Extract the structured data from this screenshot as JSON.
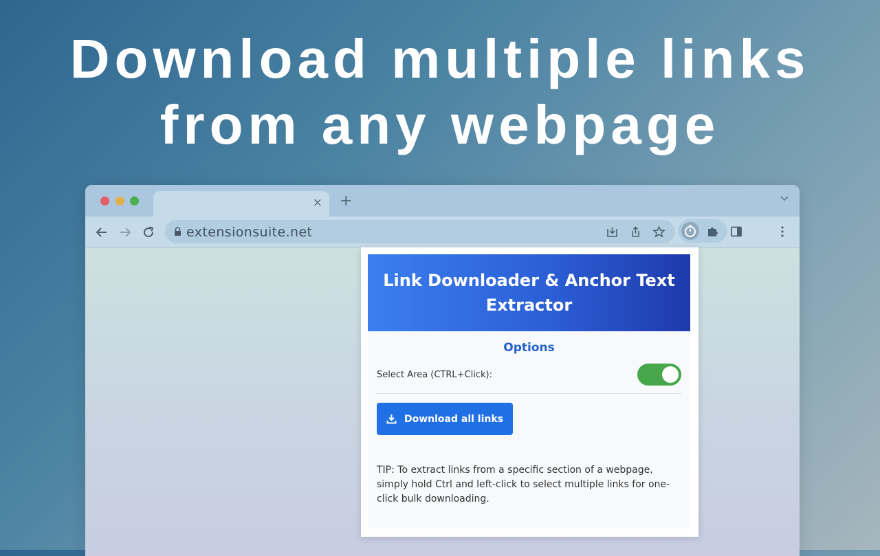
{
  "headline": {
    "line1": "Download multiple links",
    "line2": "from any webpage"
  },
  "browser": {
    "traffic_lights": [
      "#e35f67",
      "#e2b04b",
      "#4ab04f"
    ],
    "new_tab_label": "+",
    "tab_close_label": "×",
    "url": "extensionsuite.net"
  },
  "popup": {
    "title": "Link Downloader & Anchor Text Extractor",
    "options_heading": "Options",
    "select_area_label": "Select Area (CTRL+Click):",
    "select_area_enabled": true,
    "download_button_label": "Download all links",
    "tip": "TIP: To extract links from a specific section of a webpage, simply hold Ctrl and left-click to select multiple links for one-click bulk downloading."
  },
  "colors": {
    "accent": "#1f6fe5",
    "toggle_on": "#47a74a",
    "options_heading": "#2563c9"
  }
}
